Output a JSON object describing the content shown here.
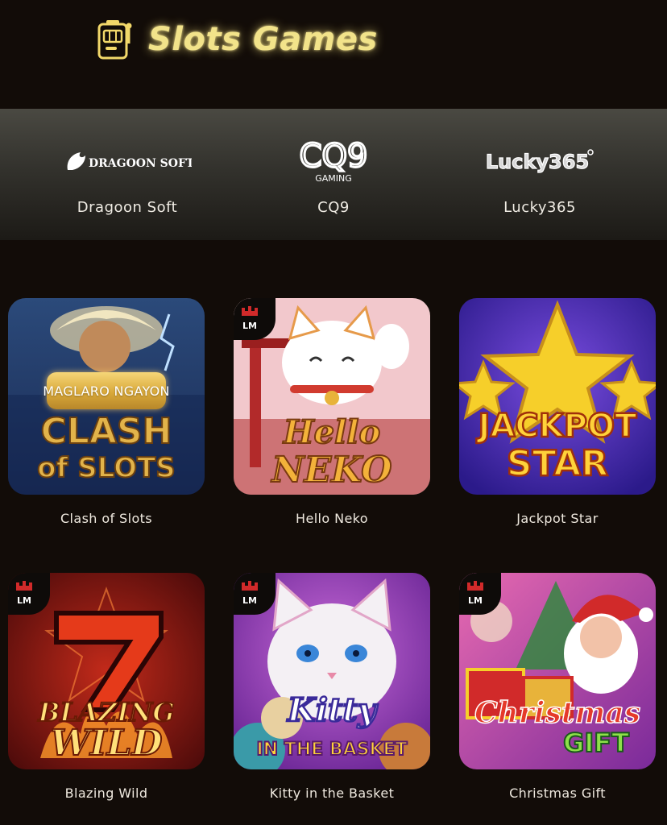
{
  "header": {
    "title": "Slots Games",
    "icon": "slot-machine-icon",
    "accent": "#f2e38a"
  },
  "providers": [
    {
      "name": "Dragoon Soft",
      "logo_text": "DRAGOON SOFT"
    },
    {
      "name": "CQ9",
      "logo_text": "CQ9",
      "logo_subtext": "GAMING"
    },
    {
      "name": "Lucky365",
      "logo_text": "Lucky365"
    }
  ],
  "play_button_label": "MAGLARO NGAYON",
  "badge_text": "LM",
  "games": [
    {
      "name": "Clash of Slots",
      "art_lines": [
        "CLASH",
        "of SLOTS"
      ],
      "badge": false,
      "hover": true
    },
    {
      "name": "Hello Neko",
      "art_lines": [
        "Hello",
        "NEKO"
      ],
      "badge": true
    },
    {
      "name": "Jackpot Star",
      "art_lines": [
        "JACKPOT",
        "STAR"
      ],
      "badge": false
    },
    {
      "name": "Blazing Wild",
      "art_lines": [
        "BLAZING",
        "WILD"
      ],
      "badge": true
    },
    {
      "name": "Kitty in the Basket",
      "art_lines": [
        "Kitty",
        "IN THE BASKET"
      ],
      "badge": true
    },
    {
      "name": "Christmas Gift",
      "art_lines": [
        "Christmas",
        "GIFT"
      ],
      "badge": true
    }
  ]
}
